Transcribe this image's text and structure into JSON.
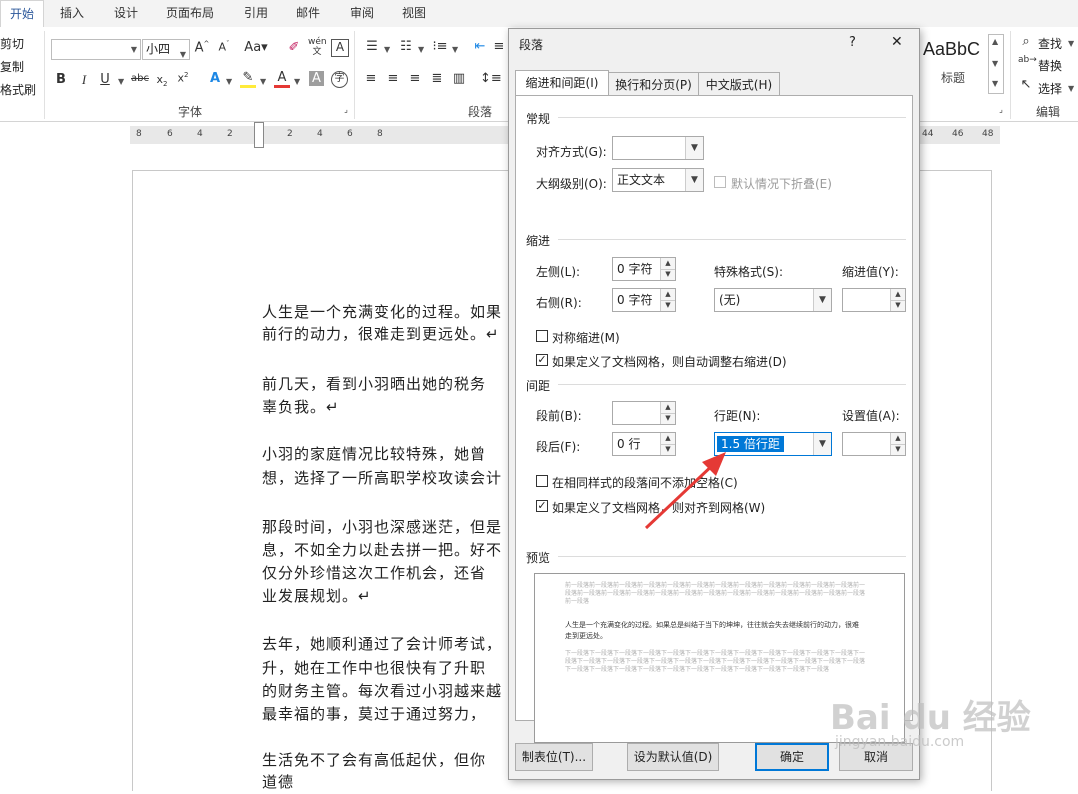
{
  "ribbon": {
    "tabs": [
      "开始",
      "插入",
      "设计",
      "页面布局",
      "引用",
      "邮件",
      "审阅",
      "视图"
    ],
    "active_tab": "开始",
    "clipboard": {
      "cut": "剪切",
      "copy": "复制",
      "format_painter": "格式刷"
    },
    "font": {
      "name_value": "",
      "size_value": "小四",
      "group_label": "字体"
    },
    "paragraph_group_label": "段落",
    "styles": {
      "sample": "AaBbC",
      "name": "标题"
    },
    "editing": {
      "find": "查找",
      "replace": "替换",
      "select": "选择",
      "group_label": "编辑"
    }
  },
  "ruler": {
    "ticks": [
      "8",
      "6",
      "4",
      "2",
      "2",
      "4",
      "6",
      "8",
      "44",
      "46",
      "48"
    ]
  },
  "document": {
    "paragraphs": [
      [
        "人生是一个充满变化的过程。如果",
        "前行的动力，很难走到更远处。↵"
      ],
      [
        "前几天，看到小羽晒出她的税务",
        "辜负我。↵"
      ],
      [
        "小羽的家庭情况比较特殊，她曾",
        "想，选择了一所高职学校攻读会计"
      ],
      [
        "那段时间，小羽也深感迷茫，但是",
        "息，不如全力以赴去拼一把。好不",
        "仅分外珍惜这次工作机会，还省",
        "业发展规划。↵"
      ],
      [
        "去年，她顺利通过了会计师考试，",
        "升，她在工作中也很快有了升职",
        "的财务主管。每次看过小羽越来越",
        "最幸福的事，莫过于通过努力，"
      ],
      [
        "生活免不了会有高低起伏，但你",
        "道德"
      ]
    ]
  },
  "dialog": {
    "title": "段落",
    "help": "?",
    "close": "✕",
    "tabs": [
      "缩进和间距(I)",
      "换行和分页(P)",
      "中文版式(H)"
    ],
    "general": {
      "section": "常规",
      "alignment_label": "对齐方式(G):",
      "alignment_value": "",
      "outline_label": "大纲级别(O):",
      "outline_value": "正文文本",
      "collapse_label": "默认情况下折叠(E)"
    },
    "indent": {
      "section": "缩进",
      "left_label": "左侧(L):",
      "left_value": "0 字符",
      "right_label": "右侧(R):",
      "right_value": "0 字符",
      "special_label": "特殊格式(S):",
      "special_value": "(无)",
      "by_label": "缩进值(Y):",
      "by_value": "",
      "mirror_label": "对称缩进(M)",
      "auto_adjust_label": "如果定义了文档网格，则自动调整右缩进(D)"
    },
    "spacing": {
      "section": "间距",
      "before_label": "段前(B):",
      "before_value": "",
      "after_label": "段后(F):",
      "after_value": "0 行",
      "line_label": "行距(N):",
      "line_value": "1.5 倍行距",
      "at_label": "设置值(A):",
      "at_value": "",
      "no_space_label": "在相同样式的段落间不添加空格(C)",
      "snap_grid_label": "如果定义了文档网格，则对齐到网格(W)"
    },
    "preview": {
      "section": "预览",
      "prev_text": "前一段落前一段落前一段落前一段落前一段落前一段落前一段落前一段落前一段落前一段落前一段落前一段落前一段落前一段落前一段落前一段落前一段落前一段落前一段落前一段落前一段落前一段落前一段落前一段落前一段落前一段落",
      "sample_text": "人生是一个充满变化的过程。如果总是纠结于当下的坤坤，往往就会失去继续前行的动力，很难走到更远处。",
      "next_text": "下一段落下一段落下一段落下一段落下一段落下一段落下一段落下一段落下一段落下一段落下一段落下一段落下一段落下一段落下一段落下一段落下一段落下一段落下一段落下一段落下一段落下一段落下一段落下一段落下一段落下一段落下一段落下一段落下一段落下一段落下一段落下一段落下一段落下一段落下一段落下一段落"
    },
    "buttons": {
      "tabs": "制表位(T)...",
      "default": "设为默认值(D)",
      "ok": "确定",
      "cancel": "取消"
    }
  },
  "watermark": {
    "logo": "Bai du 经验",
    "url": "jingyan.baidu.com"
  },
  "colors": {
    "accent": "#2b579a",
    "selection": "#0078d7",
    "arrow": "#e53935"
  }
}
